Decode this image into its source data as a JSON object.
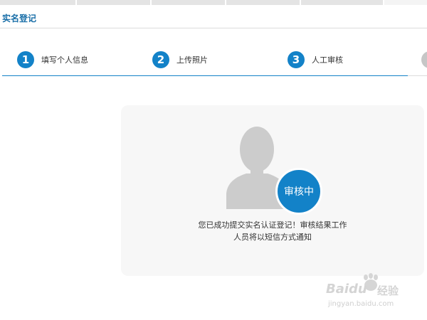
{
  "page": {
    "title": "实名登记"
  },
  "steps": [
    {
      "number": "1",
      "label": "填写个人信息"
    },
    {
      "number": "2",
      "label": "上传照片"
    },
    {
      "number": "3",
      "label": "人工审核"
    }
  ],
  "status": {
    "badge": "审核中",
    "message": "您已成功提交实名认证登记！审核结果工作人员将以短信方式通知"
  },
  "watermark": {
    "brand": "Baidu",
    "cn": "经验",
    "url": "jingyan.baidu.com"
  },
  "colors": {
    "accent": "#1382c8",
    "title": "#1a6fa8",
    "card_bg": "#f7f7f7",
    "avatar": "#cccccc"
  },
  "icons": {
    "avatar": "user-silhouette-icon",
    "watermark": "paw-icon"
  }
}
